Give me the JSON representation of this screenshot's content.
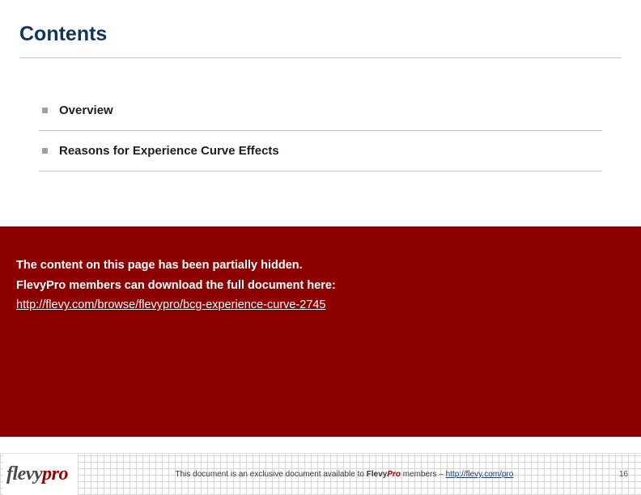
{
  "header": {
    "title": "Contents"
  },
  "items": [
    {
      "label": "Overview"
    },
    {
      "label": "Reasons for Experience Curve Effects"
    }
  ],
  "hidden": {
    "line1": "The content on this page has been partially hidden.",
    "line2": "FlevyPro members can download the full document here:",
    "link": "http://flevy.com/browse/flevypro/bcg-experience-curve-2745"
  },
  "footer": {
    "logo1": "flevy",
    "logo2": "pro",
    "text_prefix": "This document is an exclusive document available to ",
    "brand1": "Flevy",
    "brand2": "Pro",
    "text_mid": " members – ",
    "url": "http://flevy.com/pro",
    "page": "16"
  }
}
